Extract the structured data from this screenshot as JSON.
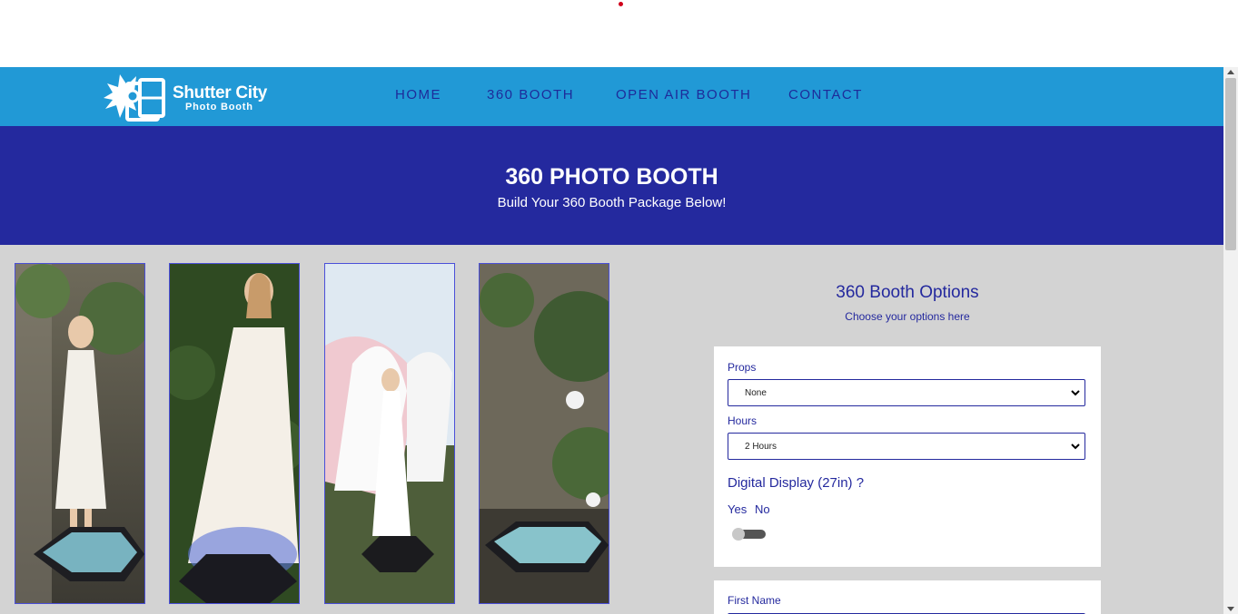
{
  "brand": {
    "line1": "Shutter City",
    "line2": "Photo Booth"
  },
  "nav": {
    "home": "HOME",
    "booth360": "360 BOOTH",
    "open_air": "OPEN AIR BOOTH",
    "contact": "CONTACT"
  },
  "hero": {
    "title": "360 PHOTO BOOTH",
    "subtitle": "Build Your 360 Booth Package Below!"
  },
  "options": {
    "title": "360 Booth Options",
    "subtitle": "Choose your options here",
    "props": {
      "label": "Props",
      "value": "None"
    },
    "hours": {
      "label": "Hours",
      "value": "2 Hours"
    },
    "digital_display": {
      "label": "Digital Display (27in) ?",
      "yes": "Yes",
      "no": "No",
      "selected": "No"
    }
  },
  "contact_form": {
    "first_name_label": "First Name"
  },
  "colors": {
    "nav_bg": "#2199d6",
    "hero_bg": "#24299e",
    "accent_text": "#24299e",
    "page_bg": "#d3d3d3"
  }
}
